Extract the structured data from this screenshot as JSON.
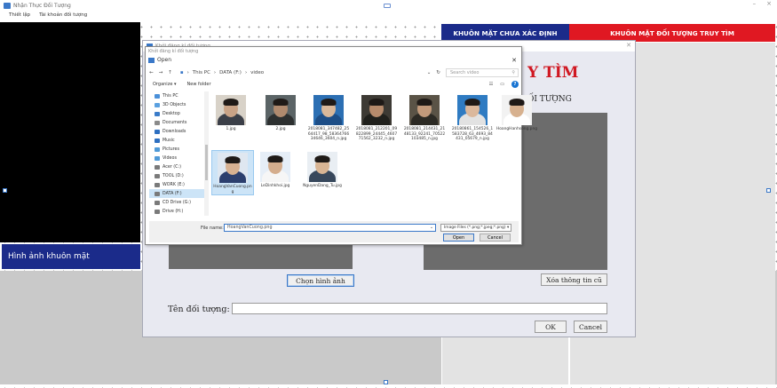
{
  "window": {
    "title": "Nhận Thực Đối Tượng",
    "controls": [
      "–",
      "×"
    ]
  },
  "menu": [
    {
      "label": "Thiết lập"
    },
    {
      "label": "Tài khoản đối tượng"
    }
  ],
  "camera": {
    "face_label": "Hình ảnh khuôn mặt"
  },
  "headers": {
    "unknown_faces": "KHUÔN MẶT CHƯA XÁC ĐỊNH",
    "wanted_faces": "KHUÔN MẶT ĐỐI TƯỢNG TRUY TÌM"
  },
  "register_dialog": {
    "title": "Khởi đăng kí đối tượng",
    "heading": "Y TÌM",
    "subheading": "ỐI TƯỢNG",
    "choose_image_button": "Chọn hình ảnh",
    "clear_button": "Xóa thông tin cũ",
    "name_label": "Tên đối tượng:",
    "name_value": "",
    "ok_button": "OK",
    "cancel_button": "Cancel"
  },
  "open_dialog": {
    "title": "Open",
    "address": {
      "crumbs": [
        "This PC",
        "DATA (F:)",
        "video"
      ],
      "search_placeholder": "Search video"
    },
    "toolbar": {
      "organize": "Organize ▾",
      "new_folder": "New folder"
    },
    "nav": [
      {
        "label": "This PC",
        "color": "#4a90d9"
      },
      {
        "label": "3D Objects",
        "color": "#5aa0e0"
      },
      {
        "label": "Desktop",
        "color": "#3a7cc9"
      },
      {
        "label": "Documents",
        "color": "#8a8a8a"
      },
      {
        "label": "Downloads",
        "color": "#2e6fc0"
      },
      {
        "label": "Music",
        "color": "#2e6fc0"
      },
      {
        "label": "Pictures",
        "color": "#4f9ad8"
      },
      {
        "label": "Videos",
        "color": "#4f9ad8"
      },
      {
        "label": "Acer (C:)",
        "color": "#7a7a7a"
      },
      {
        "label": "TOOL (D:)",
        "color": "#7a7a7a"
      },
      {
        "label": "WORK (E:)",
        "color": "#7a7a7a"
      },
      {
        "label": "DATA (F:)",
        "color": "#7a7a7a",
        "selected": true
      },
      {
        "label": "CD Drive (G:)",
        "color": "#7a7a7a"
      },
      {
        "label": "Drive (H:)",
        "color": "#7a7a7a"
      }
    ],
    "files": [
      {
        "name": "1.jpg",
        "bg": "#d8d2c8",
        "face": "#c9a386",
        "shirt": "#3b3f48"
      },
      {
        "name": "2.jpg",
        "bg": "#5b6466",
        "face": "#b08a6e",
        "shirt": "#2d3030"
      },
      {
        "name": "2018081_347482_2564417_98_5836476634646_3604_n.jpg",
        "bg": "#2c6fb3",
        "face": "#d9b89a",
        "shirt": "#1d4e87"
      },
      {
        "name": "2018081_212201_09822899_24445_460771562_3232_n.jpg",
        "bg": "#3d3a34",
        "face": "#b78b6c",
        "shirt": "#20201c"
      },
      {
        "name": "2018081_214431_2148133_92241_70522103485_n.jpg",
        "bg": "#5a5346",
        "face": "#c29a7b",
        "shirt": "#2c2a24"
      },
      {
        "name": "20180861_154526_1583728_63_4693_84431_05679_n.jpg",
        "bg": "#2f7bc2",
        "face": "#dbb89c",
        "shirt": "#e2e2e2"
      },
      {
        "name": "HoangHanhsong.png",
        "bg": "#f2f2f2",
        "face": "#d7b18f",
        "shirt": "#ffffff"
      },
      {
        "name": "HoangVanCuong.png",
        "bg": "#dfe7f0",
        "face": "#d7b191",
        "shirt": "#2c3f6e",
        "selected": true
      },
      {
        "name": "LeDinhkhoi.jpg",
        "bg": "#e6eef7",
        "face": "#d4ad8d",
        "shirt": "#f6f6f6"
      },
      {
        "name": "NguyenDang_Tu.jpg",
        "bg": "#e9eef3",
        "face": "#d9b594",
        "shirt": "#38485c"
      }
    ],
    "file_name_label": "File name:",
    "file_name_value": "HoangVanCuong.png",
    "filter": "Image Files (*.png;*.jpeg;*.png) ▾",
    "open_button": "Open",
    "cancel_button": "Cancel"
  }
}
